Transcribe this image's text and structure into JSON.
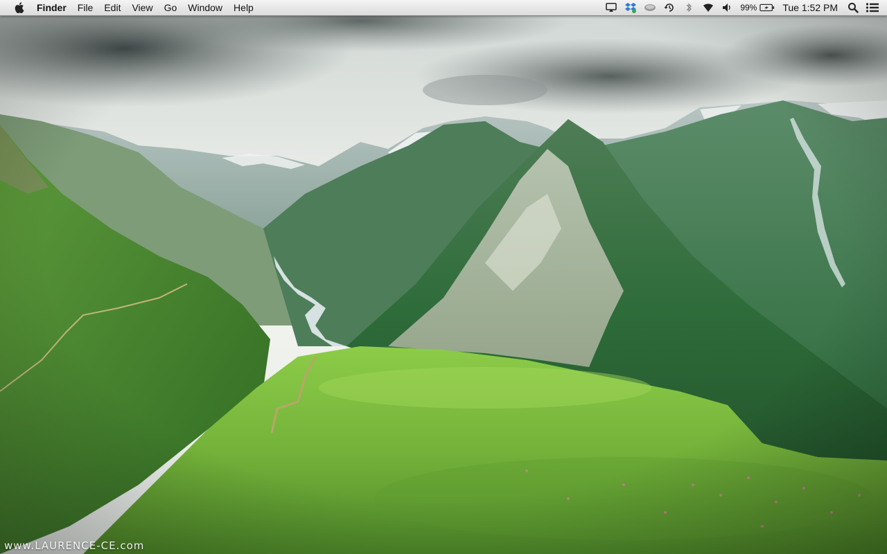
{
  "menubar": {
    "apple_icon": "apple-logo-icon",
    "app_name": "Finder",
    "menus": [
      "File",
      "Edit",
      "View",
      "Go",
      "Window",
      "Help"
    ],
    "status": {
      "icons": [
        "airplay-icon",
        "dropbox-icon",
        "drive-icon",
        "time-machine-icon",
        "bluetooth-icon",
        "wifi-icon",
        "volume-icon"
      ],
      "battery_percent": "99%",
      "clock": "Tue 1:52 PM",
      "spotlight_icon": "spotlight-search-icon",
      "notification_icon": "notification-center-icon"
    }
  },
  "desktop": {
    "wallpaper": "mountain-valley-wallpaper",
    "watermark": "www.LAURENCE-CE.com",
    "colors": {
      "sky": "#e9eeea",
      "cloud": "#4a5352",
      "mountain_far": "#9fb2b0",
      "forest": "#2f7a3a",
      "meadow": "#7fbf3a",
      "river": "#dfe9ee"
    }
  }
}
